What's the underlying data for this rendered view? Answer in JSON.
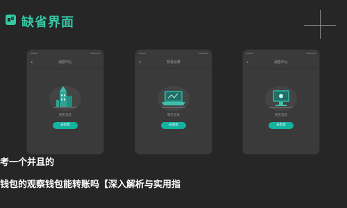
{
  "header": {
    "title": "缺省界面",
    "logo_icon": "app-logo-icon",
    "accent_color": "#34c8a5"
  },
  "screens": [
    {
      "nav_title": "消息中心",
      "back_icon": "chevron-left-icon",
      "illustration_icon": "empty-building-illustration-icon",
      "empty_text": "暂无消息",
      "button_label": "去逛逛"
    },
    {
      "nav_title": "交易记录",
      "back_icon": "chevron-left-icon",
      "illustration_icon": "empty-laptop-illustration-icon",
      "empty_text": "暂无记录",
      "button_label": "去逛逛"
    },
    {
      "nav_title": "消息中心",
      "back_icon": "chevron-left-icon",
      "illustration_icon": "empty-monitor-illustration-icon",
      "empty_text": "暂无消息",
      "button_label": "去逛逛"
    }
  ],
  "button_color": "#14b2a1",
  "caption": {
    "line1": "考一个并且的",
    "line2": "钱包的观察钱包能转账吗【深入解析与实用指"
  }
}
